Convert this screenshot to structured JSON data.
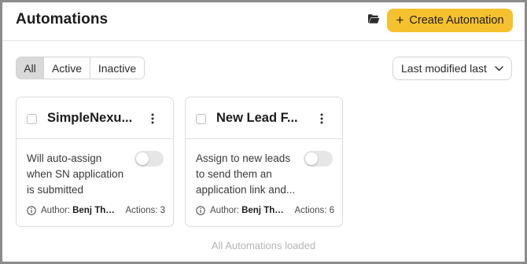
{
  "header": {
    "title": "Automations",
    "folder_icon": "folder-open-icon",
    "create_button_label": "Create Automation",
    "create_button_color": "#f6c12f"
  },
  "filters": {
    "tabs": [
      {
        "label": "All",
        "selected": true
      },
      {
        "label": "Active",
        "selected": false
      },
      {
        "label": "Inactive",
        "selected": false
      }
    ],
    "sort_selected": "Last modified last"
  },
  "cards": [
    {
      "title": "SimpleNexu...",
      "description": "Will auto-assign when SN application is submitted",
      "enabled": false,
      "author_label": "Author:",
      "author_name": "Benj Tho...",
      "actions_label": "Actions: 3"
    },
    {
      "title": "New Lead F...",
      "description": "Assign to new leads to send them an application link and...",
      "enabled": false,
      "author_label": "Author:",
      "author_name": "Benj Tho...",
      "actions_label": "Actions: 6"
    }
  ],
  "footer": {
    "status_text": "All Automations loaded"
  }
}
